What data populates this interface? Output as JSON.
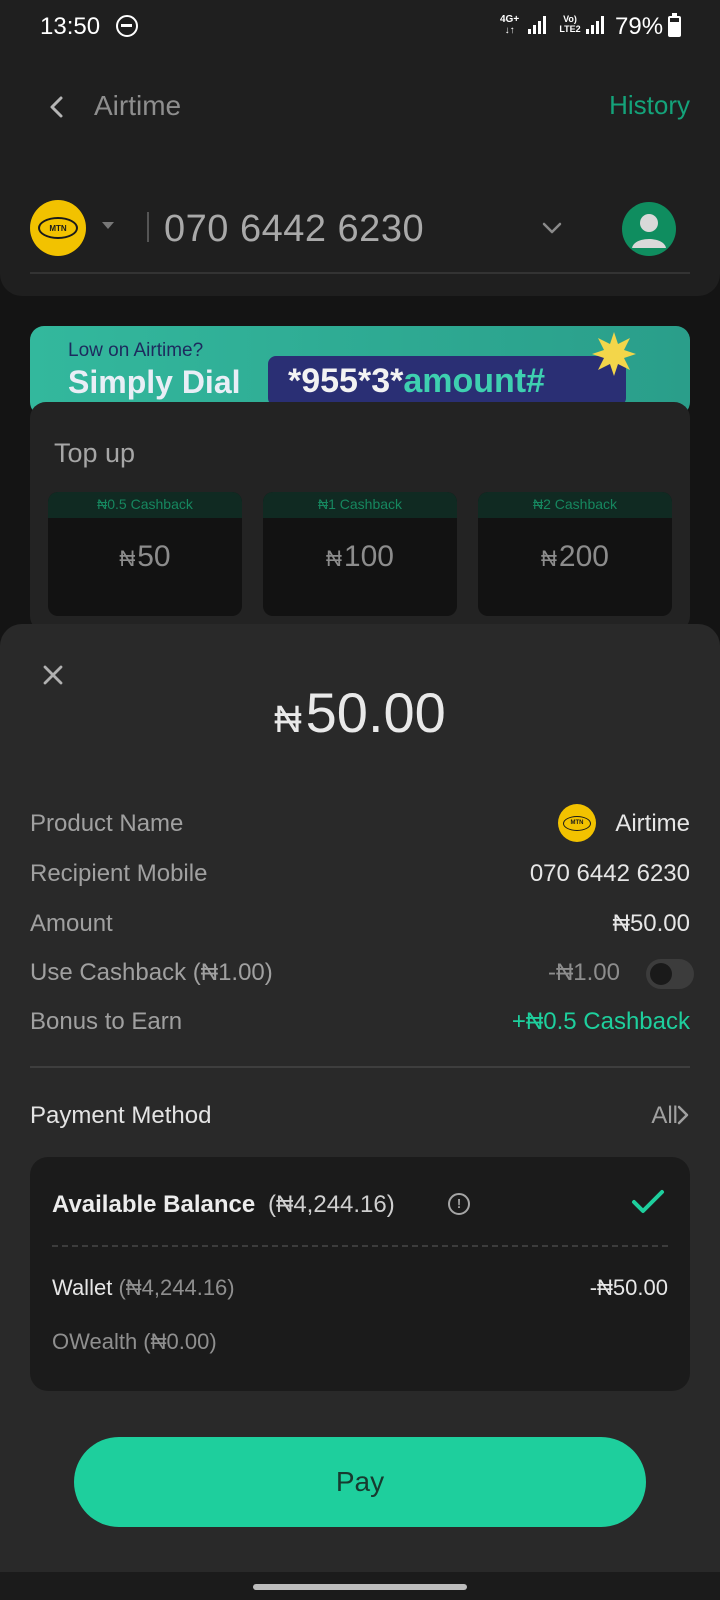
{
  "status_bar": {
    "time": "13:50",
    "network": "4G+",
    "volte": "Vo) LTE2",
    "battery": "79%"
  },
  "header": {
    "title": "Airtime",
    "history_label": "History"
  },
  "recipient": {
    "operator_logo_text": "MTN",
    "phone_number": "070 6442 6230"
  },
  "banner": {
    "small_text": "Low on Airtime?",
    "big_text": "Simply Dial",
    "code_prefix": "*955*3*",
    "code_suffix": "amount#"
  },
  "topup": {
    "heading": "Top up",
    "currency": "₦",
    "tiles": [
      {
        "cashback": "₦0.5 Cashback",
        "amount": "50"
      },
      {
        "cashback": "₦1 Cashback",
        "amount": "100"
      },
      {
        "cashback": "₦2 Cashback",
        "amount": "200"
      }
    ]
  },
  "sheet": {
    "currency": "₦",
    "amount": "50.00",
    "details": {
      "product_name_label": "Product Name",
      "product_name_value": "Airtime",
      "recipient_label": "Recipient Mobile",
      "recipient_value": "070 6442 6230",
      "amount_label": "Amount",
      "amount_value": "₦50.00",
      "cashback_label": "Use Cashback (₦1.00)",
      "cashback_value": "-₦1.00",
      "cashback_enabled": false,
      "bonus_label": "Bonus to Earn",
      "bonus_value": "+₦0.5 Cashback"
    },
    "payment": {
      "label": "Payment Method",
      "all_label": "All",
      "balance_title": "Available Balance",
      "balance_amount": "(₦4,244.16)",
      "balance_selected": true,
      "wallet_label": "Wallet",
      "wallet_sub": "(₦4,244.16)",
      "wallet_value": "-₦50.00",
      "owealth_label": "OWealth (₦0.00)"
    },
    "pay_label": "Pay"
  },
  "colors": {
    "accent": "#1ecf9d",
    "history_green": "#14a37a",
    "mtn_yellow": "#f2c200",
    "banner_code_bg": "#2a2f74"
  }
}
